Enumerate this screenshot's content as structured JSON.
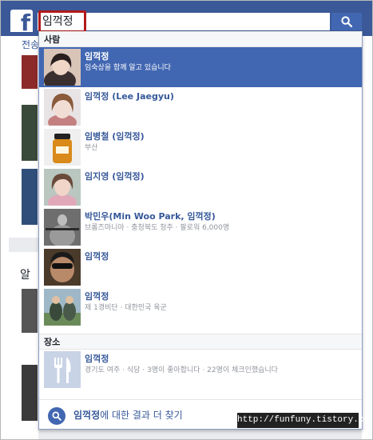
{
  "search": {
    "value": "임꺽정",
    "placeholder": ""
  },
  "background": {
    "tab_label": "전송",
    "section_text": "알"
  },
  "sections": {
    "people": "사람",
    "places": "장소"
  },
  "people": [
    {
      "name": "임꺽정",
      "sub": "임숙상을 함께 알고 있습니다",
      "selected": true
    },
    {
      "name": "임꺽정 (Lee Jaegyu)",
      "sub": "",
      "selected": false
    },
    {
      "name": "임병철 (임꺽정)",
      "sub": "부산",
      "selected": false
    },
    {
      "name": "임지영 (임꺽정)",
      "sub": "",
      "selected": false
    },
    {
      "name": "박민우(Min Woo Park, 임꺽정)",
      "sub": "브롬즈마니아 · 충청북도 청주 · 팔로워 6,000명",
      "selected": false
    },
    {
      "name": "임꺽정",
      "sub": "",
      "selected": false
    },
    {
      "name": "임꺽정",
      "sub": "제 1경비단 · 대한민국 육군",
      "selected": false
    }
  ],
  "places": [
    {
      "name": "임꺽정",
      "sub": "경기도 여주 · 식당 · 3명이 좋아합니다 · 22명이 체크인했습니다"
    }
  ],
  "more": {
    "query": "임꺽정",
    "suffix": "에 대한 결과 더 찾기"
  },
  "watermark": "http://funfuny.tistory.com",
  "colors": {
    "brand": "#3b5998",
    "selected_row": "#4267b2",
    "link": "#365899",
    "highlight_border": "#b11a1a"
  },
  "icons": {
    "logo": "facebook-logo",
    "search": "magnifier-icon",
    "place": "fork-knife-icon"
  }
}
